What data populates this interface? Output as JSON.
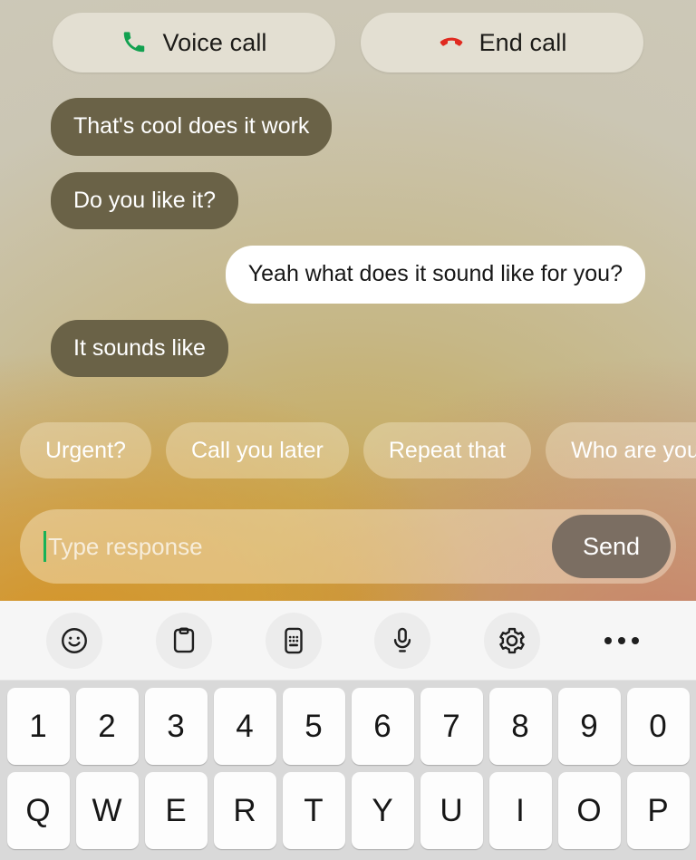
{
  "call_actions": [
    {
      "label": "Voice call",
      "icon": "phone-icon",
      "icon_color": "#12a150"
    },
    {
      "label": "End call",
      "icon": "phone-hangup-icon",
      "icon_color": "#e02a20"
    }
  ],
  "conversation": [
    {
      "side": "incoming",
      "text": "That's cool does it work"
    },
    {
      "side": "incoming",
      "text": "Do you like it?"
    },
    {
      "side": "outgoing",
      "text": "Yeah what does it sound like for you?"
    },
    {
      "side": "incoming",
      "text": "It sounds like"
    }
  ],
  "quick_replies": [
    {
      "label": "Urgent?"
    },
    {
      "label": "Call you later"
    },
    {
      "label": "Repeat that"
    },
    {
      "label": "Who are you?"
    }
  ],
  "composer": {
    "placeholder": "Type response",
    "value": "",
    "send_label": "Send",
    "caret_color": "#17b257"
  },
  "keyboard": {
    "toolbar": [
      {
        "icon": "emoji-smiley-icon"
      },
      {
        "icon": "clipboard-icon"
      },
      {
        "icon": "keypad-icon"
      },
      {
        "icon": "microphone-icon"
      },
      {
        "icon": "gear-icon"
      },
      {
        "icon": "more-options-icon"
      }
    ],
    "rows": [
      [
        "1",
        "2",
        "3",
        "4",
        "5",
        "6",
        "7",
        "8",
        "9",
        "0"
      ],
      [
        "Q",
        "W",
        "E",
        "R",
        "T",
        "Y",
        "U",
        "I",
        "O",
        "P"
      ]
    ]
  },
  "colors": {
    "bubble_incoming": "#6a6247",
    "bubble_outgoing": "#ffffff",
    "send_button": "#7b6e62",
    "call_button": "#e3dfd2",
    "keyboard_bg": "#d9d9d9",
    "key_bg": "#fdfdfd"
  }
}
